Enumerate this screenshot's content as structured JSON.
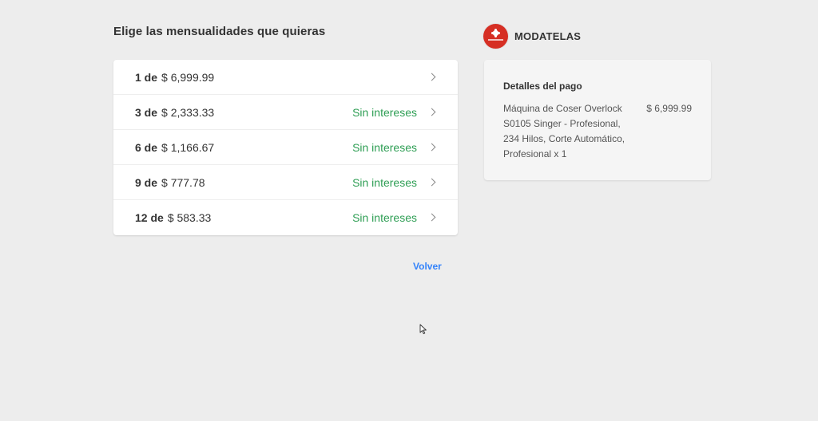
{
  "page": {
    "title": "Elige las mensualidades que quieras"
  },
  "installments": [
    {
      "qty": "1 de",
      "amount": "$ 6,999.99",
      "badge": ""
    },
    {
      "qty": "3 de",
      "amount": "$ 2,333.33",
      "badge": "Sin intereses"
    },
    {
      "qty": "6 de",
      "amount": "$ 1,166.67",
      "badge": "Sin intereses"
    },
    {
      "qty": "9 de",
      "amount": "$ 777.78",
      "badge": "Sin intereses"
    },
    {
      "qty": "12 de",
      "amount": "$ 583.33",
      "badge": "Sin intereses"
    }
  ],
  "back_link": "Volver",
  "merchant": {
    "name": "MODATELAS"
  },
  "details": {
    "title": "Detalles del pago",
    "item": "Máquina de Coser Overlock S0105 Singer - Profesional, 234 Hilos, Corte Automático, Profesional x 1",
    "price": "$ 6,999.99"
  },
  "colors": {
    "background": "#ededed",
    "accent_green": "#2e9e54",
    "link_blue": "#3483fa",
    "brand_red": "#d62f24"
  },
  "icons": {
    "row_chevron": "chevron-right-icon",
    "merchant_logo": "modatelas-logo",
    "pointer": "mouse-cursor-icon"
  }
}
